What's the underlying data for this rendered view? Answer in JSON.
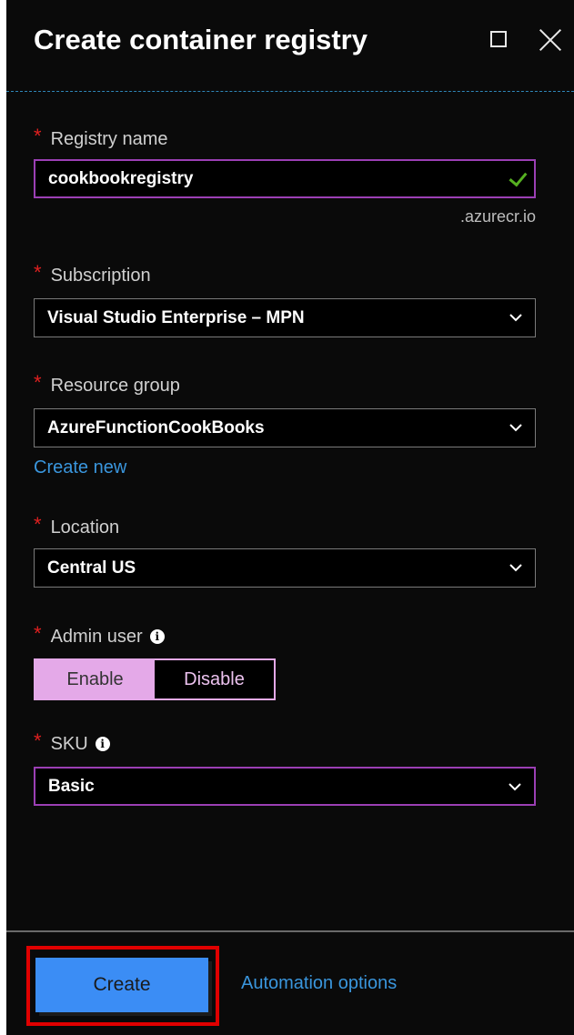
{
  "header": {
    "title": "Create container registry"
  },
  "registry_name": {
    "label": "Registry name",
    "value": "cookbookregistry",
    "suffix": ".azurecr.io"
  },
  "subscription": {
    "label": "Subscription",
    "value": "Visual Studio Enterprise – MPN"
  },
  "resource_group": {
    "label": "Resource group",
    "value": "AzureFunctionCookBooks",
    "create_new": "Create new"
  },
  "location": {
    "label": "Location",
    "value": "Central US"
  },
  "admin_user": {
    "label": "Admin user",
    "enable": "Enable",
    "disable": "Disable",
    "selected": "Enable"
  },
  "sku": {
    "label": "SKU",
    "value": "Basic"
  },
  "footer": {
    "create": "Create",
    "automation": "Automation options"
  },
  "required_marker": "*",
  "colors": {
    "accent_purple": "#9b3fb4",
    "toggle_pink": "#e4a9e8",
    "link_blue": "#3a96dd",
    "create_blue": "#3b8df5",
    "highlight_red": "#e00000",
    "check_green": "#56b021"
  }
}
